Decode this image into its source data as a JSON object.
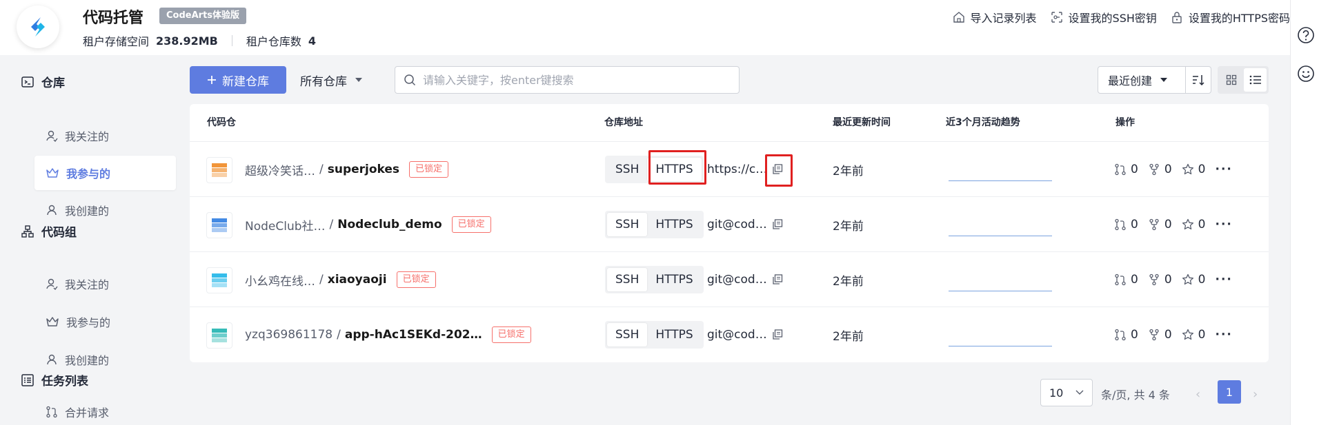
{
  "header": {
    "title": "代码托管",
    "badge": "CodeArts体验版",
    "storage_label": "租户存储空间",
    "storage_value": "238.92MB",
    "repo_count_label": "租户仓库数",
    "repo_count_value": "4",
    "links": {
      "import": "导入记录列表",
      "ssh": "设置我的SSH密钥",
      "https": "设置我的HTTPS密码"
    }
  },
  "sidebar": {
    "repo_group": "仓库",
    "repo_items": [
      "我关注的",
      "我参与的",
      "我创建的"
    ],
    "codegroup_group": "代码组",
    "codegroup_items": [
      "我关注的",
      "我参与的",
      "我创建的"
    ],
    "task_group": "任务列表",
    "task_items": [
      "合并请求"
    ]
  },
  "toolbar": {
    "new_repo": "新建仓库",
    "filter": "所有仓库",
    "search_placeholder": "请输入关键字，按enter键搜索",
    "sort": "最近创建"
  },
  "table": {
    "headers": {
      "repo": "代码仓",
      "address": "仓库地址",
      "updated": "最近更新时间",
      "trend": "近3个月活动趋势",
      "ops": "操作"
    },
    "rows": [
      {
        "group": "超级冷笑话…",
        "name": "superjokes",
        "lock": "已锁定",
        "ssh": "SSH",
        "https": "HTTPS",
        "active": "https",
        "address": "https://c…",
        "updated": "2年前",
        "mr": "0",
        "fork": "0",
        "star": "0",
        "icon_color": "#f08a24"
      },
      {
        "group": "NodeClub社…",
        "name": "Nodeclub_demo",
        "lock": "已锁定",
        "ssh": "SSH",
        "https": "HTTPS",
        "active": "ssh",
        "address": "git@cod…",
        "updated": "2年前",
        "mr": "0",
        "fork": "0",
        "star": "0",
        "icon_color": "#2f7de1"
      },
      {
        "group": "小幺鸡在线…",
        "name": "xiaoyaoji",
        "lock": "已锁定",
        "ssh": "SSH",
        "https": "HTTPS",
        "active": "ssh",
        "address": "git@cod…",
        "updated": "2年前",
        "mr": "0",
        "fork": "0",
        "star": "0",
        "icon_color": "#1fb5e8"
      },
      {
        "group": "yzq369861178",
        "name": "app-hAc1SEKd-202…",
        "lock": "已锁定",
        "ssh": "SSH",
        "https": "HTTPS",
        "active": "ssh",
        "address": "git@cod…",
        "updated": "2年前",
        "mr": "0",
        "fork": "0",
        "star": "0",
        "icon_color": "#20b4b0"
      }
    ]
  },
  "pagination": {
    "page_size": "10",
    "info": "条/页, 共 4 条",
    "current": "1"
  },
  "colors": {
    "primary": "#5e7ce0",
    "lock": "#f66f6a",
    "highlight": "#e02020"
  }
}
